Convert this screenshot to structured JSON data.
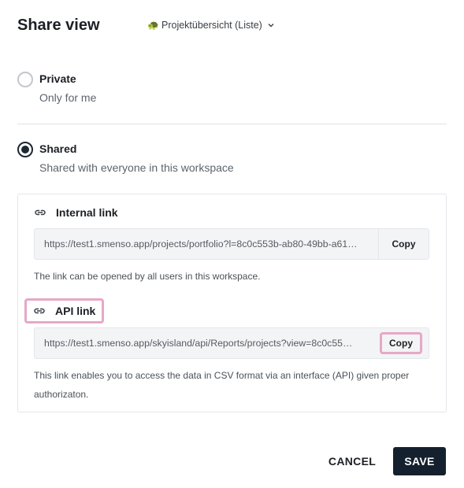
{
  "dialog": {
    "title": "Share view",
    "view_selector": {
      "icon": "turtle-emoji-icon",
      "emoji": "🐢",
      "label": "Projektübersicht (Liste)"
    }
  },
  "options": {
    "private": {
      "label": "Private",
      "description": "Only for me",
      "selected": false
    },
    "shared": {
      "label": "Shared",
      "description": "Shared with everyone in this workspace",
      "selected": true
    }
  },
  "internal_link": {
    "title": "Internal link",
    "url": "https://test1.smenso.app/projects/portfolio?l=8c0c553b-ab80-49bb-a61…",
    "copy_label": "Copy",
    "note": "The link can be opened by all users in this workspace."
  },
  "api_link": {
    "title": "API link",
    "url": "https://test1.smenso.app/skyisland/api/Reports/projects?view=8c0c55…",
    "copy_label": "Copy",
    "note": "This link enables you to access the data in CSV format via an interface (API) given proper authorizaton."
  },
  "footer": {
    "cancel_label": "CANCEL",
    "save_label": "SAVE"
  },
  "colors": {
    "primary": "#14202e",
    "highlight": "#e7a8c7",
    "field_bg": "#f3f4f6"
  }
}
